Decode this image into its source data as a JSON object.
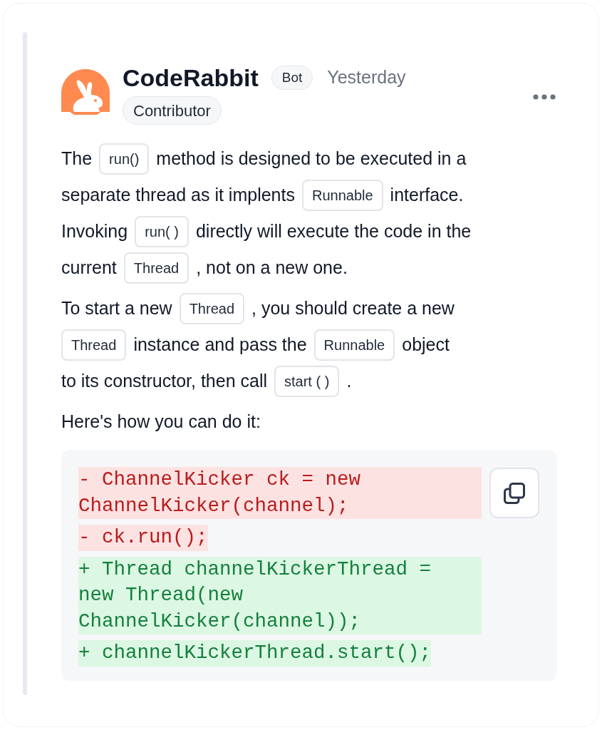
{
  "comment": {
    "author": "CodeRabbit",
    "author_badge": "Bot",
    "time": "Yesterday",
    "role_badge": "Contributor",
    "paragraphs": [
      {
        "lines": [
          [
            {
              "kind": "text",
              "text": "The"
            },
            {
              "kind": "code",
              "text": "run()"
            },
            {
              "kind": "text",
              "text": "method is designed to be executed in a"
            }
          ],
          [
            {
              "kind": "text",
              "text": "separate thread as it implents"
            },
            {
              "kind": "code",
              "text": "Runnable"
            },
            {
              "kind": "text",
              "text": "interface."
            }
          ],
          [
            {
              "kind": "text",
              "text": "Invoking"
            },
            {
              "kind": "code",
              "text": "run( )"
            },
            {
              "kind": "text",
              "text": "directly will execute the code in the"
            }
          ],
          [
            {
              "kind": "text",
              "text": "current"
            },
            {
              "kind": "code",
              "text": "Thread"
            },
            {
              "kind": "text",
              "text": ", not on a new one."
            }
          ]
        ]
      },
      {
        "lines": [
          [
            {
              "kind": "text",
              "text": "To start a new"
            },
            {
              "kind": "code",
              "text": "Thread"
            },
            {
              "kind": "text",
              "text": ", you should create a new"
            }
          ],
          [
            {
              "kind": "code",
              "text": "Thread"
            },
            {
              "kind": "text",
              "text": "instance and pass the"
            },
            {
              "kind": "code",
              "text": "Runnable"
            },
            {
              "kind": "text",
              "text": "object"
            }
          ],
          [
            {
              "kind": "text",
              "text": "to its constructor, then call"
            },
            {
              "kind": "code",
              "text": "start ( )"
            },
            {
              "kind": "text",
              "text": "."
            }
          ]
        ]
      },
      {
        "lines": [
          [
            {
              "kind": "text",
              "text": "Here's how you can do it:"
            }
          ]
        ]
      }
    ],
    "diff": [
      {
        "kind": "removed",
        "lines": [
          "- ChannelKicker ck = new",
          "ChannelKicker(channel);"
        ]
      },
      {
        "kind": "removed",
        "lines": [
          "- ck.run();"
        ]
      },
      {
        "kind": "added",
        "lines": [
          "+ Thread channelKickerThread =",
          "new Thread(new",
          "ChannelKicker(channel));"
        ]
      },
      {
        "kind": "added",
        "lines": [
          "+ channelKickerThread.start();"
        ]
      }
    ]
  }
}
